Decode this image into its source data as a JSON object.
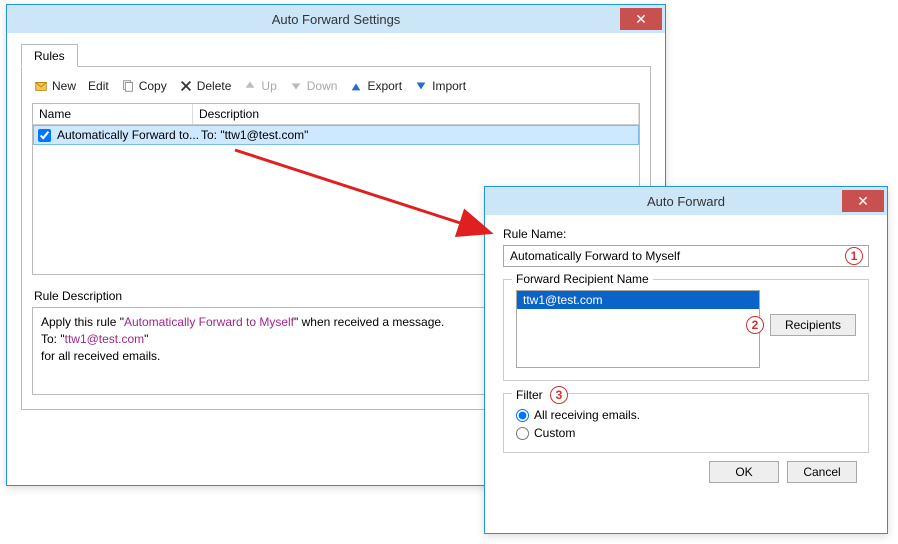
{
  "window1": {
    "title": "Auto Forward Settings",
    "tab": "Rules",
    "toolbar": {
      "new": "New",
      "edit": "Edit",
      "copy": "Copy",
      "delete": "Delete",
      "up": "Up",
      "down": "Down",
      "export": "Export",
      "import": "Import"
    },
    "columns": {
      "name": "Name",
      "description": "Description"
    },
    "row": {
      "checked": true,
      "name": "Automatically Forward to...",
      "description": "To: \"ttw1@test.com\""
    },
    "ruleDescLabel": "Rule Description",
    "ruleDesc": {
      "line1a": "Apply this rule \"",
      "hl1": "Automatically Forward to Myself",
      "line1b": "\" when received a message.",
      "line2a": "To: \"",
      "hl2": "ttw1@test.com",
      "line2b": "\"",
      "line3": "for all received emails."
    }
  },
  "window2": {
    "title": "Auto Forward",
    "ruleNameLabel": "Rule Name:",
    "ruleName": "Automatically Forward to Myself",
    "fwdLegend": "Forward Recipient Name",
    "recipient": "ttw1@test.com",
    "recipientsBtn": "Recipients",
    "filterLegend": "Filter",
    "optAll": "All receiving emails.",
    "optCustom": "Custom",
    "ok": "OK",
    "cancel": "Cancel"
  },
  "callouts": {
    "c1": "1",
    "c2": "2",
    "c3": "3"
  }
}
